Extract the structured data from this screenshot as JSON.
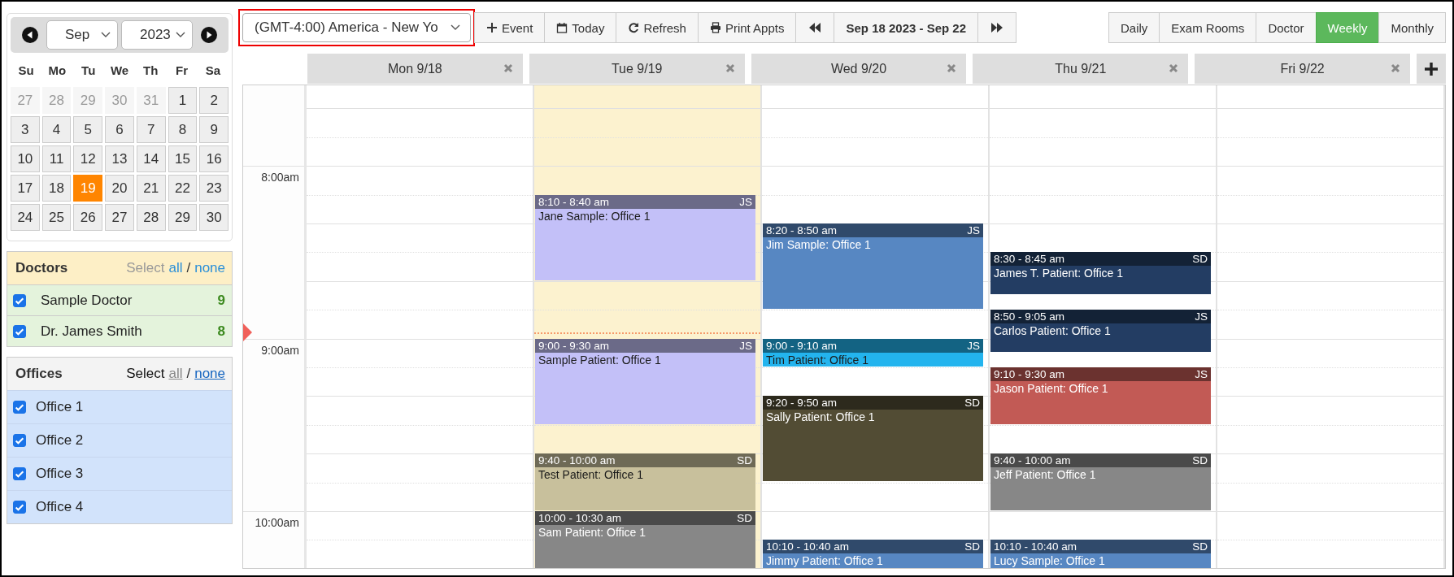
{
  "calendar": {
    "month": "Sep",
    "year": "2023",
    "weekdays": [
      "Su",
      "Mo",
      "Tu",
      "We",
      "Th",
      "Fr",
      "Sa"
    ],
    "days": [
      {
        "label": "27",
        "outside": true,
        "selected": false
      },
      {
        "label": "28",
        "outside": true,
        "selected": false
      },
      {
        "label": "29",
        "outside": true,
        "selected": false
      },
      {
        "label": "30",
        "outside": true,
        "selected": false
      },
      {
        "label": "31",
        "outside": true,
        "selected": false
      },
      {
        "label": "1",
        "outside": false,
        "selected": false
      },
      {
        "label": "2",
        "outside": false,
        "selected": false
      },
      {
        "label": "3",
        "outside": false,
        "selected": false
      },
      {
        "label": "4",
        "outside": false,
        "selected": false
      },
      {
        "label": "5",
        "outside": false,
        "selected": false
      },
      {
        "label": "6",
        "outside": false,
        "selected": false
      },
      {
        "label": "7",
        "outside": false,
        "selected": false
      },
      {
        "label": "8",
        "outside": false,
        "selected": false
      },
      {
        "label": "9",
        "outside": false,
        "selected": false
      },
      {
        "label": "10",
        "outside": false,
        "selected": false
      },
      {
        "label": "11",
        "outside": false,
        "selected": false
      },
      {
        "label": "12",
        "outside": false,
        "selected": false
      },
      {
        "label": "13",
        "outside": false,
        "selected": false
      },
      {
        "label": "14",
        "outside": false,
        "selected": false
      },
      {
        "label": "15",
        "outside": false,
        "selected": false
      },
      {
        "label": "16",
        "outside": false,
        "selected": false
      },
      {
        "label": "17",
        "outside": false,
        "selected": false
      },
      {
        "label": "18",
        "outside": false,
        "selected": false
      },
      {
        "label": "19",
        "outside": false,
        "selected": true
      },
      {
        "label": "20",
        "outside": false,
        "selected": false
      },
      {
        "label": "21",
        "outside": false,
        "selected": false
      },
      {
        "label": "22",
        "outside": false,
        "selected": false
      },
      {
        "label": "23",
        "outside": false,
        "selected": false
      },
      {
        "label": "24",
        "outside": false,
        "selected": false
      },
      {
        "label": "25",
        "outside": false,
        "selected": false
      },
      {
        "label": "26",
        "outside": false,
        "selected": false
      },
      {
        "label": "27",
        "outside": false,
        "selected": false
      },
      {
        "label": "28",
        "outside": false,
        "selected": false
      },
      {
        "label": "29",
        "outside": false,
        "selected": false
      },
      {
        "label": "30",
        "outside": false,
        "selected": false
      }
    ]
  },
  "doctors": {
    "title": "Doctors",
    "select_label": "Select",
    "select_all": "all",
    "separator": "/",
    "select_none": "none",
    "items": [
      {
        "name": "Sample Doctor",
        "checked": true,
        "count": "9"
      },
      {
        "name": "Dr. James Smith",
        "checked": true,
        "count": "8"
      }
    ]
  },
  "offices": {
    "title": "Offices",
    "select_label": "Select",
    "select_all": "all",
    "separator": "/",
    "select_none": "none",
    "items": [
      {
        "name": "Office 1",
        "checked": true
      },
      {
        "name": "Office 2",
        "checked": true
      },
      {
        "name": "Office 3",
        "checked": true
      },
      {
        "name": "Office 4",
        "checked": true
      }
    ]
  },
  "toolbar": {
    "timezone": {
      "value": "(GMT-4:00) America - New Yo",
      "highlighted": true
    },
    "actions": [
      "Event",
      "Today",
      "Refresh",
      "Print Appts"
    ],
    "date_range": "Sep 18 2023 - Sep 22",
    "views": [
      {
        "label": "Daily",
        "selected": false
      },
      {
        "label": "Exam Rooms",
        "selected": false
      },
      {
        "label": "Doctor",
        "selected": false
      },
      {
        "label": "Weekly",
        "selected": true
      },
      {
        "label": "Monthly",
        "selected": false
      }
    ]
  },
  "time_labels": [
    "8:00am",
    "9:00am",
    "10:00am"
  ],
  "days": [
    {
      "label": "Mon 9/18",
      "today": false
    },
    {
      "label": "Tue 9/19",
      "today": true,
      "events": [
        {
          "time": "8:10 - 8:40 am",
          "initials": "JS",
          "title": "Jane Sample: Office 1",
          "color": "#c3c0f8"
        },
        {
          "time": "9:00 - 9:30 am",
          "initials": "JS",
          "title": "Sample Patient: Office 1",
          "color": "#c3c0f8"
        },
        {
          "time": "9:40 - 10:00 am",
          "initials": "SD",
          "title": "Test Patient: Office 1",
          "color": "#c8c09c"
        },
        {
          "time": "10:00 - 10:30 am",
          "initials": "SD",
          "title": "Sam Patient: Office 1",
          "color": "#878787"
        }
      ]
    },
    {
      "label": "Wed 9/20",
      "today": false,
      "events": [
        {
          "time": "8:20 - 8:50 am",
          "initials": "JS",
          "title": "Jim Sample: Office 1",
          "color": "#5787c2"
        },
        {
          "time": "9:00 - 9:10 am",
          "initials": "JS",
          "title": "Tim Patient: Office 1",
          "color": "#23b4ee"
        },
        {
          "time": "9:20 - 9:50 am",
          "initials": "SD",
          "title": "Sally Patient: Office 1",
          "color": "#524c34"
        },
        {
          "time": "10:10 - 10:40 am",
          "initials": "SD",
          "title": "Jimmy Patient: Office 1",
          "color": "#5787c2"
        }
      ]
    },
    {
      "label": "Thu 9/21",
      "today": false,
      "events": [
        {
          "time": "8:30 - 8:45 am",
          "initials": "SD",
          "title": "James T. Patient: Office 1",
          "color": "#233d63"
        },
        {
          "time": "8:50 - 9:05 am",
          "initials": "JS",
          "title": "Carlos Patient: Office 1",
          "color": "#233d63"
        },
        {
          "time": "9:10 - 9:30 am",
          "initials": "JS",
          "title": "Jason Patient: Office 1",
          "color": "#c25a55"
        },
        {
          "time": "9:40 - 10:00 am",
          "initials": "SD",
          "title": "Jeff Patient: Office 1",
          "color": "#878787"
        },
        {
          "time": "10:10 - 10:40 am",
          "initials": "SD",
          "title": "Lucy Sample: Office 1",
          "color": "#5787c2"
        }
      ]
    },
    {
      "label": "Fri 9/22",
      "today": false
    }
  ]
}
